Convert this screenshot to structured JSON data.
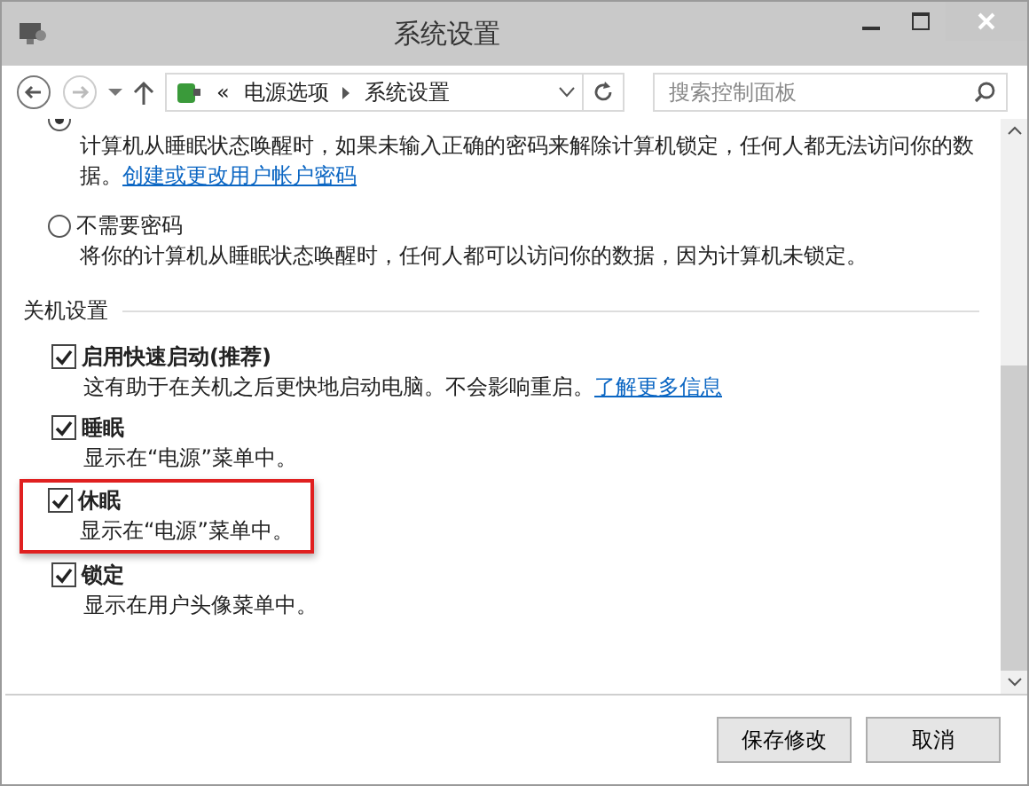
{
  "window": {
    "title": "系统设置"
  },
  "address_bar": {
    "path": [
      "电源选项",
      "系统设置"
    ],
    "prefix": "«"
  },
  "search": {
    "placeholder": "搜索控制面板"
  },
  "password_options": [
    {
      "selected": true,
      "description": "计算机从睡眠状态唤醒时，如果未输入正确的密码来解除计算机锁定，任何人都无法访问你的数据。",
      "link": "创建或更改用户帐户密码"
    },
    {
      "label": "不需要密码",
      "selected": false,
      "description": "将你的计算机从睡眠状态唤醒时，任何人都可以访问你的数据，因为计算机未锁定。"
    }
  ],
  "shutdown_section": {
    "heading": "关机设置",
    "items": [
      {
        "label": "启用快速启动(推荐)",
        "checked": true,
        "highlighted": false,
        "description": "这有助于在关机之后更快地启动电脑。不会影响重启。",
        "link": "了解更多信息"
      },
      {
        "label": "睡眠",
        "checked": true,
        "highlighted": false,
        "description": "显示在“电源”菜单中。"
      },
      {
        "label": "休眠",
        "checked": true,
        "highlighted": true,
        "description": "显示在“电源”菜单中。"
      },
      {
        "label": "锁定",
        "checked": true,
        "highlighted": false,
        "description": "显示在用户头像菜单中。"
      }
    ]
  },
  "buttons": [
    "保存修改",
    "取消"
  ]
}
